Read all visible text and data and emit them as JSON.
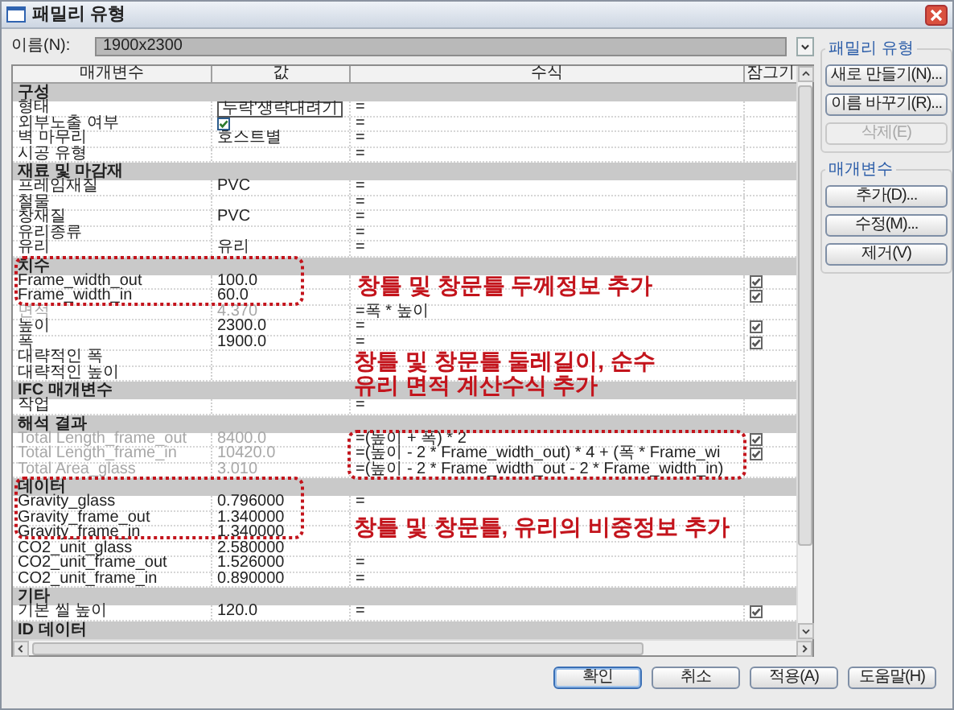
{
  "window": {
    "title": "패밀리 유형"
  },
  "name_field": {
    "label": "이름(N):",
    "value": "1900x2300"
  },
  "table": {
    "columns": [
      "매개변수",
      "값",
      "수식",
      "잠그기"
    ],
    "groups": [
      {
        "title": "구성",
        "rows": [
          {
            "parameter": "형태",
            "kind": "field",
            "value": "누락'생략내려기",
            "formula": "=",
            "locked": false,
            "disabled": false
          },
          {
            "parameter": "외부노출 여부",
            "kind": "checkbox",
            "checked": true,
            "formula": "=",
            "locked": false,
            "disabled": false
          },
          {
            "parameter": "벽 마무리",
            "kind": "text",
            "value": "호스트별",
            "formula": "=",
            "locked": false,
            "disabled": false
          },
          {
            "parameter": "시공 유형",
            "kind": "text",
            "formula": "=",
            "locked": false,
            "disabled": false
          }
        ]
      },
      {
        "title": "재료 및 마감재",
        "rows": [
          {
            "parameter": "프레임재질",
            "kind": "text",
            "value": "PVC",
            "formula": "=",
            "locked": false,
            "disabled": false
          },
          {
            "parameter": "철물",
            "kind": "text",
            "formula": "=",
            "locked": false,
            "disabled": false
          },
          {
            "parameter": "창재질",
            "kind": "text",
            "value": "PVC",
            "formula": "=",
            "locked": false,
            "disabled": false
          },
          {
            "parameter": "유리종류",
            "kind": "text",
            "formula": "=",
            "locked": false,
            "disabled": false
          },
          {
            "parameter": "유리",
            "kind": "text",
            "value": "유리",
            "formula": "=",
            "locked": false,
            "disabled": false
          }
        ]
      },
      {
        "title": "치수",
        "rows": [
          {
            "parameter": "Frame_width_out",
            "kind": "text",
            "value": "100.0",
            "locked": true,
            "disabled": false
          },
          {
            "parameter": "Frame_width_in",
            "kind": "text",
            "value": "60.0",
            "locked": true,
            "disabled": false
          },
          {
            "parameter": "면적",
            "kind": "text",
            "value": "4.370",
            "formula": "=폭 * 높이",
            "locked": false,
            "disabled": true
          },
          {
            "parameter": "높이",
            "kind": "text",
            "value": "2300.0",
            "formula": "=",
            "locked": true,
            "disabled": false
          },
          {
            "parameter": "폭",
            "kind": "text",
            "value": "1900.0",
            "formula": "=",
            "locked": true,
            "disabled": false
          },
          {
            "parameter": "대략적인 폭",
            "kind": "text",
            "locked": false,
            "disabled": false
          },
          {
            "parameter": "대략적인 높이",
            "kind": "text",
            "locked": false,
            "disabled": false
          }
        ]
      },
      {
        "title": "IFC 매개변수",
        "rows": [
          {
            "parameter": "작업",
            "kind": "text",
            "formula": "=",
            "locked": false,
            "disabled": false
          }
        ]
      },
      {
        "title": "해석 결과",
        "rows": [
          {
            "parameter": "Total Length_frame_out",
            "kind": "text",
            "value": "8400.0",
            "formula": "=(높이 + 폭) * 2",
            "locked": true,
            "disabled": true
          },
          {
            "parameter": "Total Length_frame_in",
            "kind": "text",
            "value": "10420.0",
            "formula": "=(높이 - 2 * Frame_width_out) * 4 + (폭 * Frame_wi",
            "locked": true,
            "disabled": true
          },
          {
            "parameter": "Total Area_glass",
            "kind": "text",
            "value": "3.010",
            "formula": "=(높이 - 2 * Frame_width_out - 2 * Frame_width_in)",
            "locked": false,
            "disabled": true
          }
        ]
      },
      {
        "title": "데이터",
        "rows": [
          {
            "parameter": "Gravity_glass",
            "kind": "text",
            "value": "0.796000",
            "formula": "=",
            "locked": false,
            "disabled": false
          },
          {
            "parameter": "Gravity_frame_out",
            "kind": "text",
            "value": "1.340000",
            "locked": false,
            "disabled": false
          },
          {
            "parameter": "Gravity_frame_in",
            "kind": "text",
            "value": "1.340000",
            "locked": false,
            "disabled": false
          },
          {
            "parameter": "CO2_unit_glass",
            "kind": "text",
            "value": "2.580000",
            "locked": false,
            "disabled": false
          },
          {
            "parameter": "CO2_unit_frame_out",
            "kind": "text",
            "value": "1.526000",
            "formula": "=",
            "locked": false,
            "disabled": false
          },
          {
            "parameter": "CO2_unit_frame_in",
            "kind": "text",
            "value": "0.890000",
            "formula": "=",
            "locked": false,
            "disabled": false
          }
        ]
      },
      {
        "title": "기타",
        "rows": [
          {
            "parameter": "기본 씰 높이",
            "kind": "text",
            "value": "120.0",
            "formula": "=",
            "locked": true,
            "disabled": false
          }
        ]
      },
      {
        "title": "ID 데이터"
      }
    ]
  },
  "annotations": [
    {
      "text": "창틀 및 창문틀 두께정보 추가"
    },
    {
      "text": "창틀 및 창문틀 둘레길이, 순수\n유리 면적 계산수식 추가"
    },
    {
      "text": "창틀 및 창문틀, 유리의 비중정보 추가"
    }
  ],
  "side_panel": [
    {
      "title": "패밀리 유형",
      "buttons": [
        {
          "label": "새로 만들기(N)...",
          "disabled": false
        },
        {
          "label": "이름 바꾸기(R)...",
          "disabled": false
        },
        {
          "label": "삭제(E)",
          "disabled": true
        }
      ]
    },
    {
      "title": "매개변수",
      "buttons": [
        {
          "label": "추가(D)...",
          "disabled": false
        },
        {
          "label": "수정(M)...",
          "disabled": false
        },
        {
          "label": "제거(V)",
          "disabled": false
        }
      ]
    }
  ],
  "footer_buttons": [
    {
      "label": "확인",
      "default": true
    },
    {
      "label": "취소",
      "default": false
    },
    {
      "label": "적용(A)",
      "default": false
    },
    {
      "label": "도움말(H)",
      "default": false
    }
  ]
}
